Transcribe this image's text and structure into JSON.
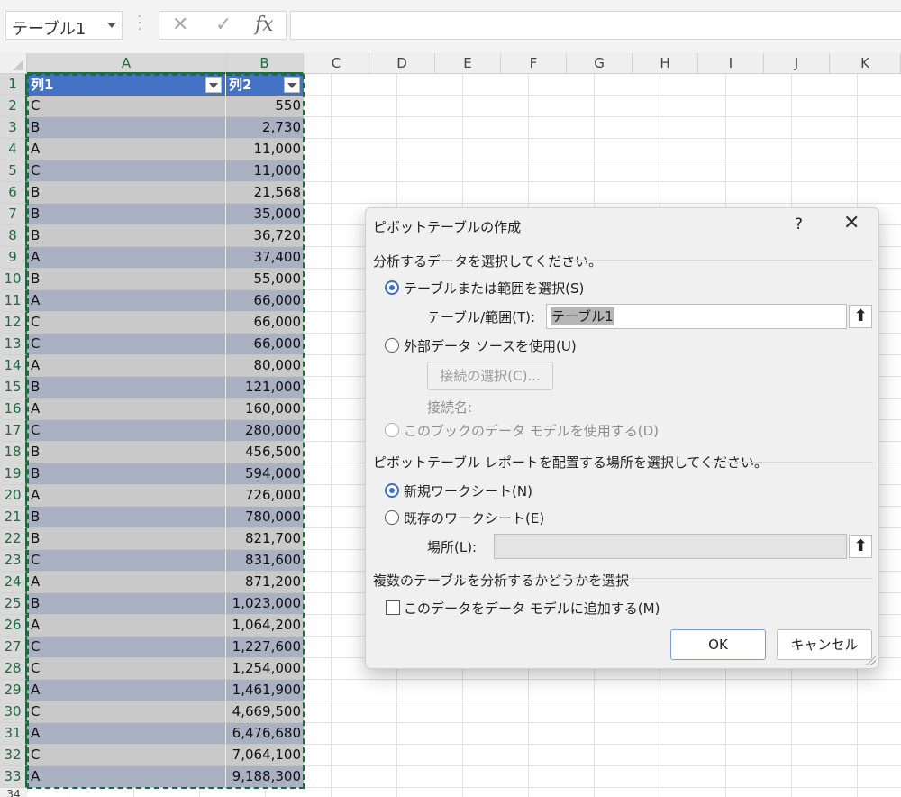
{
  "formula_bar": {
    "name_box": "テーブル1",
    "cancel_icon": "✕",
    "enter_icon": "✓",
    "fx_label": "fx",
    "formula": ""
  },
  "columns": [
    "A",
    "B",
    "C",
    "D",
    "E",
    "F",
    "G",
    "H",
    "I",
    "J",
    "K"
  ],
  "rows": [
    "1",
    "2",
    "3",
    "4",
    "5",
    "6",
    "7",
    "8",
    "9",
    "10",
    "11",
    "12",
    "13",
    "14",
    "15",
    "16",
    "17",
    "18",
    "19",
    "20",
    "21",
    "22",
    "23",
    "24",
    "25",
    "26",
    "27",
    "28",
    "29",
    "30",
    "31",
    "32",
    "33"
  ],
  "partial_row": "34",
  "table": {
    "headers": [
      "列1",
      "列2"
    ],
    "data": [
      [
        "C",
        "550"
      ],
      [
        "B",
        "2,730"
      ],
      [
        "A",
        "11,000"
      ],
      [
        "C",
        "11,000"
      ],
      [
        "B",
        "21,568"
      ],
      [
        "B",
        "35,000"
      ],
      [
        "B",
        "36,720"
      ],
      [
        "A",
        "37,400"
      ],
      [
        "B",
        "55,000"
      ],
      [
        "A",
        "66,000"
      ],
      [
        "C",
        "66,000"
      ],
      [
        "C",
        "66,000"
      ],
      [
        "A",
        "80,000"
      ],
      [
        "B",
        "121,000"
      ],
      [
        "A",
        "160,000"
      ],
      [
        "C",
        "280,000"
      ],
      [
        "B",
        "456,500"
      ],
      [
        "B",
        "594,000"
      ],
      [
        "A",
        "726,000"
      ],
      [
        "B",
        "780,000"
      ],
      [
        "B",
        "821,700"
      ],
      [
        "C",
        "831,600"
      ],
      [
        "A",
        "871,200"
      ],
      [
        "B",
        "1,023,000"
      ],
      [
        "A",
        "1,064,200"
      ],
      [
        "C",
        "1,227,600"
      ],
      [
        "C",
        "1,254,000"
      ],
      [
        "A",
        "1,461,900"
      ],
      [
        "C",
        "4,669,500"
      ],
      [
        "A",
        "6,476,680"
      ],
      [
        "C",
        "7,064,100"
      ],
      [
        "A",
        "9,188,300"
      ]
    ]
  },
  "dialog": {
    "title": "ピボットテーブルの作成",
    "help": "?",
    "close": "✕",
    "section1": "分析するデータを選択してください。",
    "opt_table_range": "テーブルまたは範囲を選択(S)",
    "table_range_label": "テーブル/範囲(T):",
    "table_range_value": "テーブル1",
    "opt_external": "外部データ ソースを使用(U)",
    "choose_connection": "接続の選択(C)...",
    "connection_name": "接続名:",
    "opt_data_model": "このブックのデータ モデルを使用する(D)",
    "section2": "ピボットテーブル レポートを配置する場所を選択してください。",
    "opt_new_sheet": "新規ワークシート(N)",
    "opt_existing_sheet": "既存のワークシート(E)",
    "location_label": "場所(L):",
    "location_value": "",
    "section3": "複数のテーブルを分析するかどうかを選択",
    "add_to_model": "このデータをデータ モデルに追加する(M)",
    "ok": "OK",
    "cancel": "キャンセル",
    "up_arrow_icon": "⬆"
  }
}
